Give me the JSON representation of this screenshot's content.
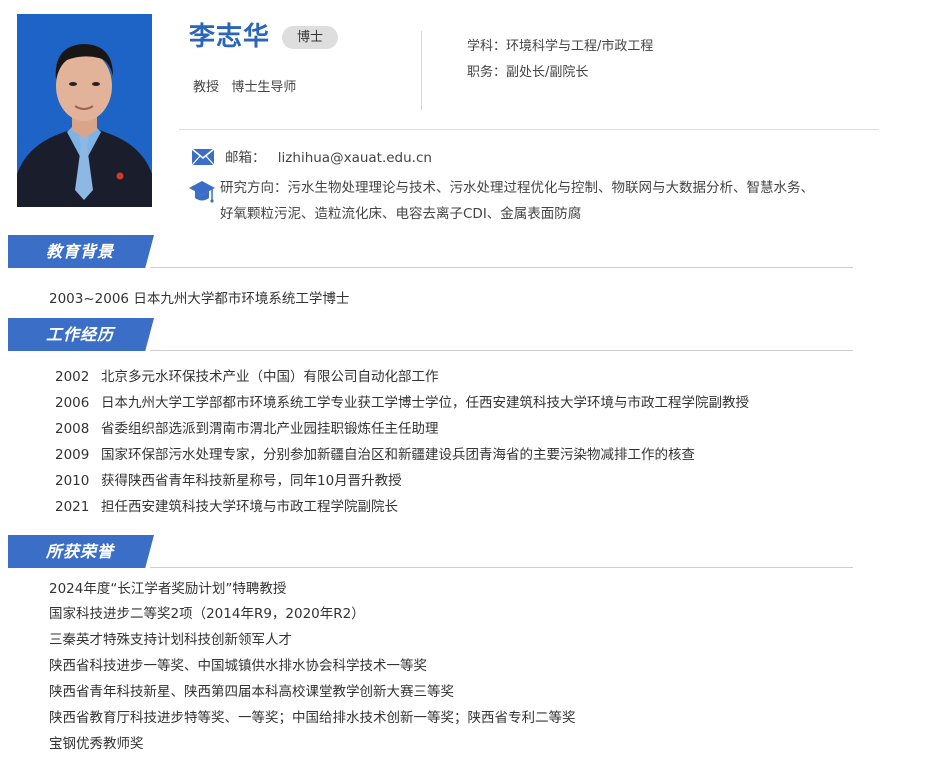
{
  "profile": {
    "name": "李志华",
    "degree_badge": "博士",
    "titles": "教授   博士生导师",
    "discipline_label": "学科：",
    "discipline_value": "环境科学与工程/市政工程",
    "position_label": "职务：",
    "position_value": "副处长/副院长",
    "email_label": "邮箱：",
    "email_value": "lizhihua@xauat.edu.cn",
    "research_label": "研究方向：",
    "research_value_line1": "污水生物处理理论与技术、污水处理过程优化与控制、物联网与大数据分析、智慧水务、",
    "research_value_line2": "好氧颗粒污泥、造粒流化床、电容去离子CDI、金属表面防腐"
  },
  "sections": {
    "education": {
      "title": "教育背景",
      "items": [
        "2003~2006   日本九州大学都市环境系统工学博士"
      ]
    },
    "work": {
      "title": "工作经历",
      "items": [
        {
          "year": "2002",
          "text": "北京多元水环保技术产业（中国）有限公司自动化部工作"
        },
        {
          "year": "2006",
          "text": "日本九州大学工学部都市环境系统工学专业获工学博士学位，任西安建筑科技大学环境与市政工程学院副教授"
        },
        {
          "year": "2008",
          "text": "省委组织部选派到渭南市渭北产业园挂职锻炼任主任助理"
        },
        {
          "year": "2009",
          "text": "国家环保部污水处理专家，分别参加新疆自治区和新疆建设兵团青海省的主要污染物减排工作的核查"
        },
        {
          "year": "2010",
          "text": "获得陕西省青年科技新星称号，同年10月晋升教授"
        },
        {
          "year": "2021",
          "text": "担任西安建筑科技大学环境与市政工程学院副院长"
        }
      ]
    },
    "honors": {
      "title": "所获荣誉",
      "items": [
        "2024年度“长江学者奖励计划”特聘教授",
        "国家科技进步二等奖2项（2014年R9，2020年R2）",
        "三秦英才特殊支持计划科技创新领军人才",
        "陕西省科技进步一等奖、中国城镇供水排水协会科学技术一等奖",
        "陕西省青年科技新星、陕西第四届本科高校课堂教学创新大赛三等奖",
        "陕西省教育厅科技进步特等奖、一等奖；中国给排水技术创新一等奖；陕西省专利二等奖",
        "宝钢优秀教师奖"
      ]
    }
  },
  "colors": {
    "accent": "#3b6fc7",
    "name": "#2b65b8"
  },
  "icons": {
    "mail": "envelope-icon",
    "research": "graduation-cap-icon"
  }
}
